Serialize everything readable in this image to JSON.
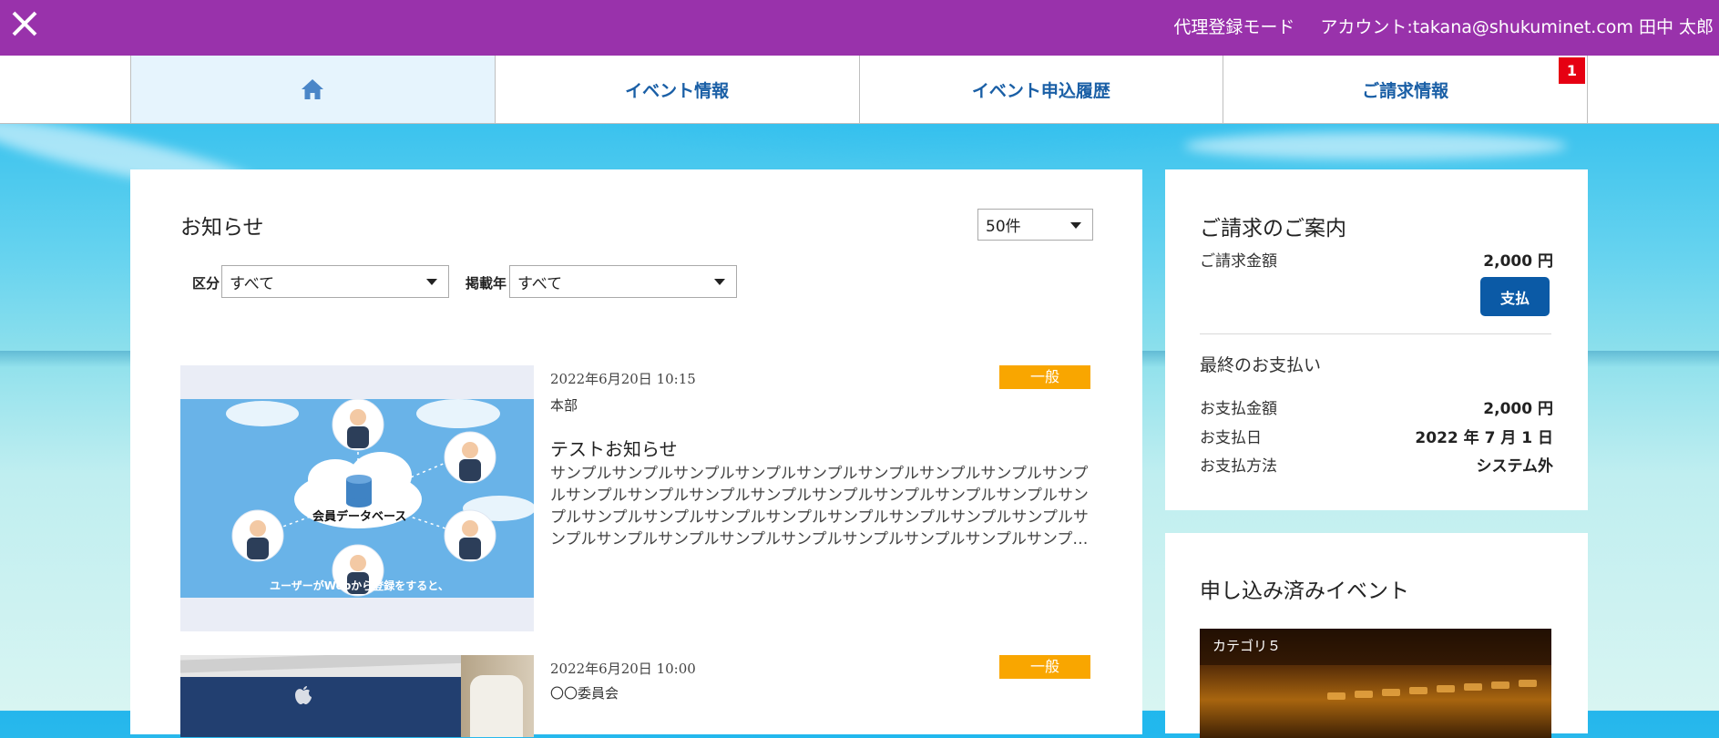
{
  "header": {
    "mode_label": "代理登録モード",
    "account_label": "アカウント:takana@shukuminet.com 田中 太郎"
  },
  "nav": {
    "tabs": [
      {
        "label": "",
        "icon": "home-icon"
      },
      {
        "label": "イベント情報"
      },
      {
        "label": "イベント申込履歴"
      },
      {
        "label": "ご請求情報",
        "badge": "1"
      }
    ]
  },
  "news": {
    "title": "お知らせ",
    "per_page": "50件",
    "filters": {
      "category_label": "区分",
      "category_value": "すべて",
      "year_label": "掲載年",
      "year_value": "すべて"
    },
    "items": [
      {
        "date": "2022年6月20日 10:15",
        "org": "本部",
        "category": "一般",
        "title": "テストお知らせ",
        "body": "サンプルサンプルサンプルサンプルサンプルサンプルサンプルサンプルサンプルサンプルサンプルサンプルサンプルサンプルサンプルサンプルサンプルサンプルサンプルサンプルサンプルサンプルサンプルサンプルサンプルサンプルサンプルサンプルサンプルサンプルサンプルサンプルサンプルサンプルサンプルサンプルサンプル",
        "image_caption": "会員データベース",
        "image_subtitle": "ユーザーがWebから登録をすると、"
      },
      {
        "date": "2022年6月20日 10:00",
        "org": "〇〇委員会",
        "category": "一般"
      }
    ]
  },
  "billing": {
    "title": "ご請求のご案内",
    "amount_label": "ご請求金額",
    "amount_value": "2,000 円",
    "pay_button": "支払",
    "last_payment_title": "最終のお支払い",
    "paid_amount_label": "お支払金額",
    "paid_amount_value": "2,000 円",
    "paid_date_label": "お支払日",
    "paid_date_value": "2022 年 7 月 1 日",
    "method_label": "お支払方法",
    "method_value": "システム外"
  },
  "events": {
    "title": "申し込み済みイベント",
    "first_category": "カテゴリ５"
  },
  "colors": {
    "header_bg": "#9932ab",
    "nav_text": "#1a5fa6",
    "badge_red": "#e60012",
    "category_orange": "#f9a600",
    "pay_button": "#0b5aa6"
  }
}
